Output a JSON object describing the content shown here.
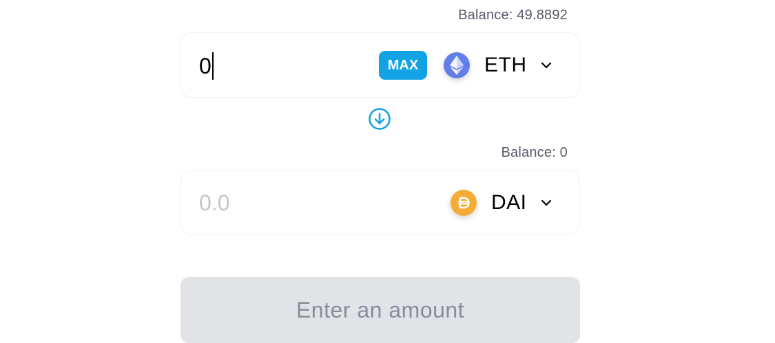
{
  "from": {
    "balance_text": "Balance: 49.8892",
    "amount": "0",
    "max_label": "MAX",
    "token": {
      "symbol": "ETH",
      "icon": "eth-logo-icon",
      "color": "#627eea"
    }
  },
  "switch": {
    "icon": "arrow-down-circle-icon",
    "color": "#13a3e4"
  },
  "to": {
    "balance_text": "Balance: 0",
    "amount_placeholder": "0.0",
    "token": {
      "symbol": "DAI",
      "icon": "dai-logo-icon",
      "color": "#f5ac37"
    }
  },
  "action": {
    "label": "Enter an amount"
  },
  "colors": {
    "accent": "#13a3e4",
    "disabled_bg": "#e2e3e6",
    "disabled_text": "#888d9b",
    "placeholder": "#c3c5cb"
  }
}
